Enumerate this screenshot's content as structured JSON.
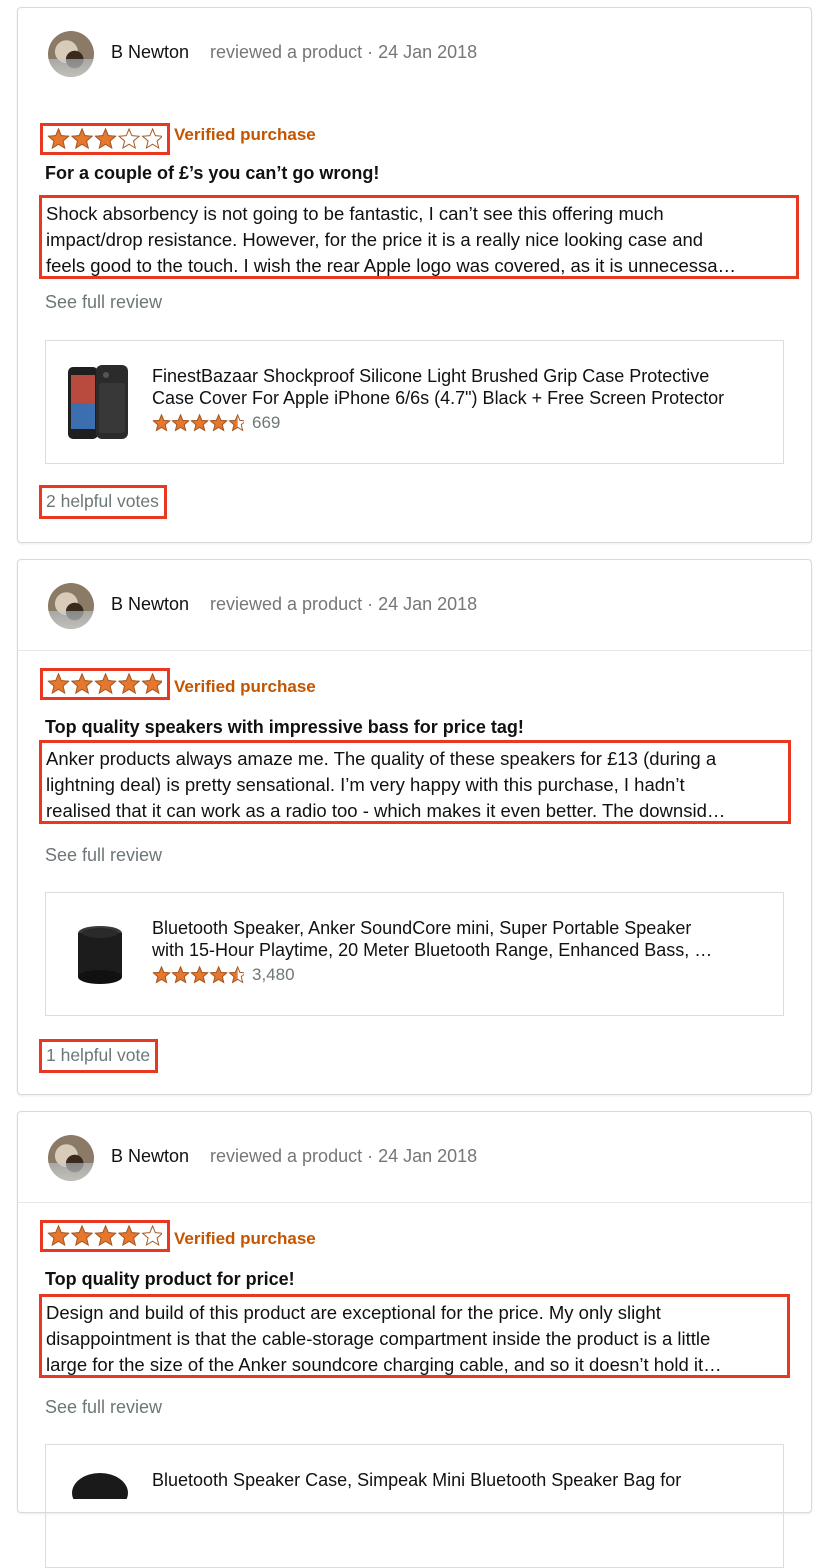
{
  "colors": {
    "star": "#e8772e",
    "star_stroke": "#a45a25",
    "verified": "#c45500",
    "annotation": "#e8381f",
    "muted": "#767676"
  },
  "reviews": [
    {
      "reviewer": "B Newton",
      "meta": "reviewed a product · 24 Jan 2018",
      "rating": 3,
      "verified_label": "Verified purchase",
      "title": "For a couple of £’s you can’t go wrong!",
      "body_lines": [
        "Shock absorbency is not going to be fantastic, I can’t see this offering much",
        "impact/drop resistance. However, for the price it is a really nice looking case and",
        "feels good to the touch. I wish the rear Apple logo was covered, as it is unnecessa…"
      ],
      "see_full": "See full review",
      "product": {
        "title_lines": [
          "FinestBazaar Shockproof Silicone Light Brushed Grip Case Protective",
          "Case Cover For Apple iPhone 6/6s (4.7\") Black + Free Screen Protector"
        ],
        "rating": 4.5,
        "rating_count": "669",
        "image_icon": "phone-case-image"
      },
      "helpful": "2 helpful votes"
    },
    {
      "reviewer": "B Newton",
      "meta": "reviewed a product · 24 Jan 2018",
      "rating": 5,
      "verified_label": "Verified purchase",
      "title": "Top quality speakers with impressive bass for price tag!",
      "body_lines": [
        "Anker products always amaze me. The quality of these speakers for £13 (during a",
        "lightning deal) is pretty sensational. I’m very happy with this purchase, I hadn’t",
        "realised that it can work as a radio too - which makes it even better. The downsid…"
      ],
      "see_full": "See full review",
      "product": {
        "title_lines": [
          "Bluetooth Speaker, Anker SoundCore mini, Super Portable Speaker",
          "with 15-Hour Playtime, 20 Meter Bluetooth Range, Enhanced Bass, …"
        ],
        "rating": 4.5,
        "rating_count": "3,480",
        "image_icon": "speaker-image"
      },
      "helpful": "1 helpful vote"
    },
    {
      "reviewer": "B Newton",
      "meta": "reviewed a product · 24 Jan 2018",
      "rating": 4,
      "verified_label": "Verified purchase",
      "title": "Top quality product for price!",
      "body_lines": [
        "Design and build of this product are exceptional for the price. My only slight",
        "disappointment is that the cable-storage compartment inside the product is a little",
        "large for the size of the Anker soundcore charging cable, and so it doesn’t hold it…"
      ],
      "see_full": "See full review",
      "product": {
        "title_lines": [
          "Bluetooth Speaker Case, Simpeak Mini Bluetooth Speaker Bag for"
        ],
        "image_icon": "speaker-case-image"
      }
    }
  ]
}
